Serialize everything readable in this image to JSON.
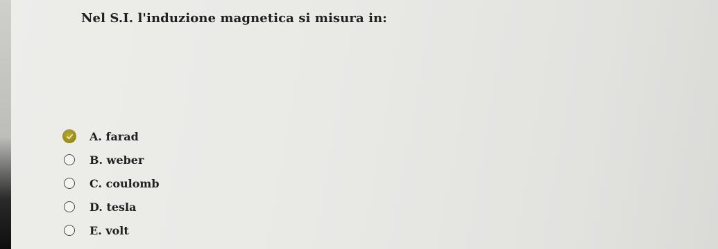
{
  "question": "Nel S.I. l'induzione magnetica si misura in:",
  "selected_index": 0,
  "accent_color": "#a6991f",
  "options": [
    {
      "label": "A. farad",
      "selected": true
    },
    {
      "label": "B. weber",
      "selected": false
    },
    {
      "label": "C. coulomb",
      "selected": false
    },
    {
      "label": "D. tesla",
      "selected": false
    },
    {
      "label": "E. volt",
      "selected": false
    }
  ]
}
